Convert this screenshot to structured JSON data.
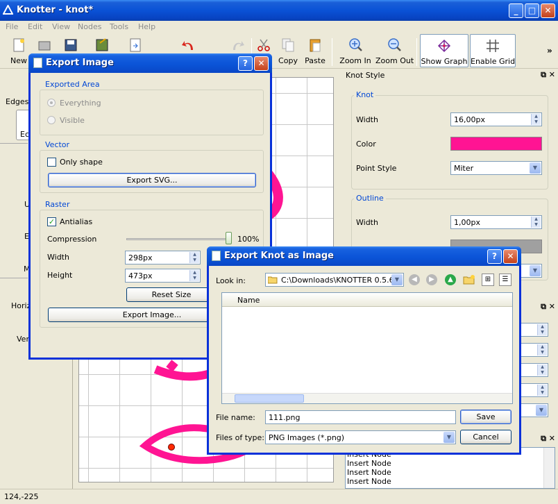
{
  "window": {
    "title": "Knotter - knot*",
    "min": "_",
    "max": "□",
    "close": "✕"
  },
  "menu": [
    "File",
    "Edit",
    "View",
    "Nodes",
    "Tools",
    "Help"
  ],
  "toolbar": {
    "new": "New",
    "copy": "Copy",
    "paste": "Paste",
    "zoom_in": "Zoom In",
    "zoom_out": "Zoom Out",
    "show_graph": "Show Graph",
    "enable_grid": "Enable Grid",
    "more": "»"
  },
  "left": {
    "edges": "Edges",
    "edges_btn": "Ec",
    "u": "U",
    "e": "E",
    "m": "M",
    "horiz": "Horiz",
    "vert": "Vert"
  },
  "knot_style": {
    "title": "Knot Style",
    "knot_group": "Knot",
    "width_label": "Width",
    "width_value": "16,00px",
    "color_label": "Color",
    "color_value": "#ff1493",
    "point_style_label": "Point Style",
    "point_style_value": "Miter",
    "outline_group": "Outline",
    "outline_width_label": "Width",
    "outline_width_value": "1,00px",
    "outline_color_value": "#a0a0a0"
  },
  "history": {
    "items": [
      "Insert Node",
      "Insert Node",
      "Insert Node",
      "Insert Node"
    ]
  },
  "status": {
    "coords": "124,-225"
  },
  "export_image": {
    "title": "Export Image",
    "help": "?",
    "close": "✕",
    "area_group": "Exported Area",
    "everything": "Everything",
    "visible": "Visible",
    "vector_group": "Vector",
    "only_shape": "Only shape",
    "export_svg": "Export SVG...",
    "raster_group": "Raster",
    "antialias": "Antialias",
    "compression": "Compression",
    "compression_value": "100%",
    "width_label": "Width",
    "width_value": "298px",
    "height_label": "Height",
    "height_value": "473px",
    "reset_size": "Reset Size",
    "export_image_btn": "Export Image..."
  },
  "file_dialog": {
    "title": "Export Knot as Image",
    "help": "?",
    "close": "✕",
    "look_in_label": "Look in:",
    "look_in_value": "C:\\Downloads\\KNOTTER 0.5.6",
    "column_name": "Name",
    "file_name_label": "File name:",
    "file_name_value": "111.png",
    "file_type_label": "Files of type:",
    "file_type_value": "PNG Images (*.png)",
    "save": "Save",
    "cancel": "Cancel"
  },
  "colors": {
    "accent": "#0a52d6",
    "knot": "#ff1493"
  }
}
